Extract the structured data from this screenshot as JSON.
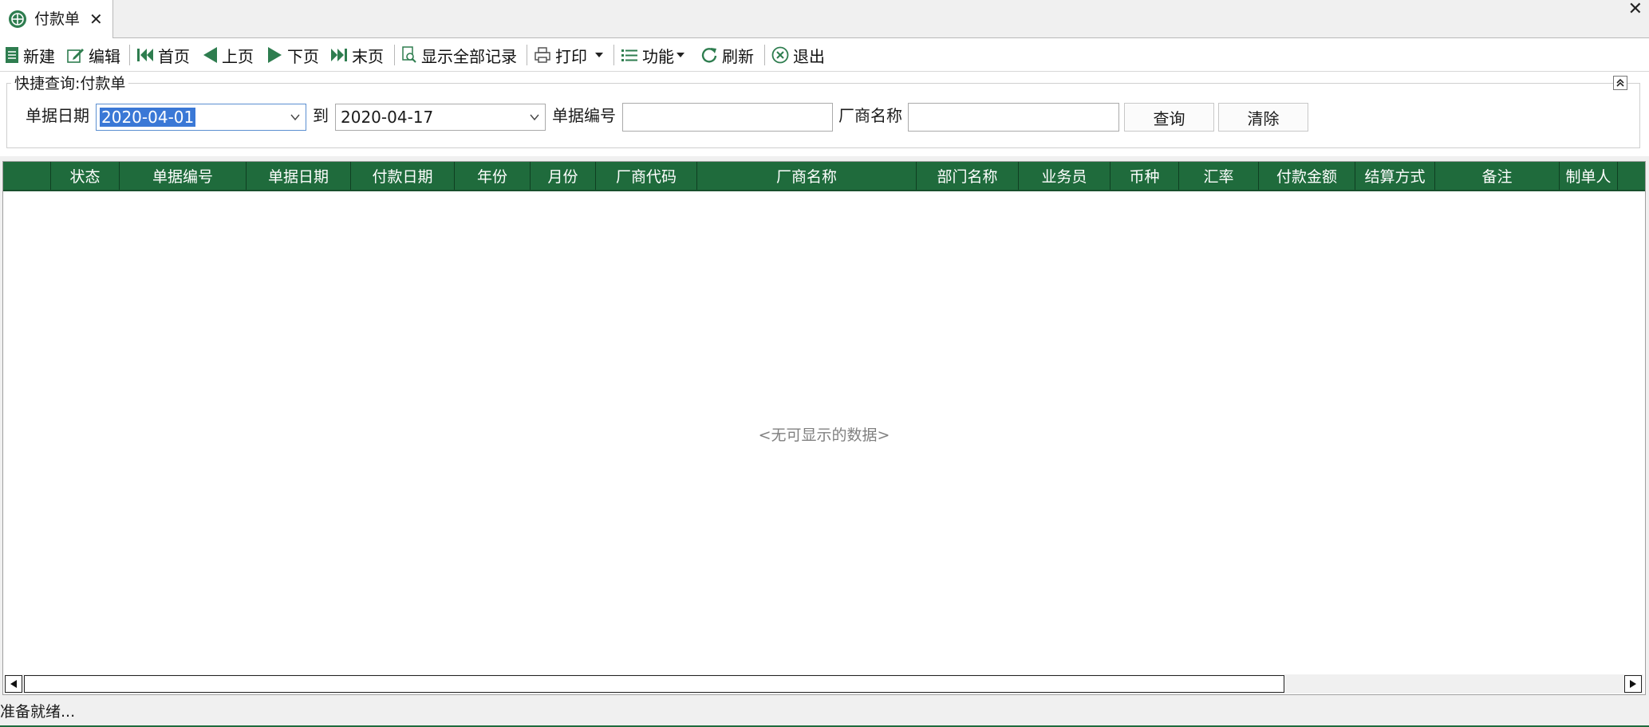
{
  "tab": {
    "title": "付款单",
    "close": "✕"
  },
  "window": {
    "close": "✕"
  },
  "toolbar": {
    "new": "新建",
    "edit": "编辑",
    "first": "首页",
    "prev": "上页",
    "next": "下页",
    "last": "末页",
    "show_all": "显示全部记录",
    "print": "打印",
    "function": "功能",
    "refresh": "刷新",
    "exit": "退出"
  },
  "query": {
    "title": "快捷查询:付款单",
    "date_label": "单据日期",
    "date_from": "2020-04-01",
    "to_label": "到",
    "date_to": "2020-04-17",
    "doc_no_label": "单据编号",
    "doc_no_value": "",
    "vendor_label": "厂商名称",
    "vendor_value": "",
    "query_button": "查询",
    "clear_button": "清除"
  },
  "grid": {
    "columns": [
      "状态",
      "单据编号",
      "单据日期",
      "付款日期",
      "年份",
      "月份",
      "厂商代码",
      "厂商名称",
      "部门名称",
      "业务员",
      "币种",
      "汇率",
      "付款金额",
      "结算方式",
      "备注",
      "制单人"
    ],
    "empty_text": "<无可显示的数据>"
  },
  "status": {
    "text": "准备就绪..."
  },
  "colors": {
    "header_bg": "#1f6b3c",
    "header_text": "#ffffff",
    "selection": "#3a78d6"
  }
}
